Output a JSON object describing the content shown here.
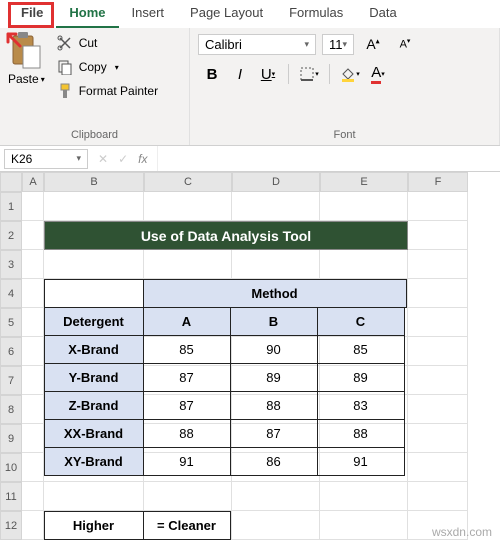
{
  "ribbon": {
    "tabs": {
      "file": "File",
      "home": "Home",
      "insert": "Insert",
      "pageLayout": "Page Layout",
      "formulas": "Formulas",
      "data": "Data"
    }
  },
  "clipboard": {
    "paste": "Paste",
    "cut": "Cut",
    "copy": "Copy",
    "formatPainter": "Format Painter",
    "groupLabel": "Clipboard"
  },
  "font": {
    "name": "Calibri",
    "size": "11",
    "groupLabel": "Font"
  },
  "namebox": "K26",
  "colHeaders": [
    "A",
    "B",
    "C",
    "D",
    "E",
    "F"
  ],
  "rowHeaders": [
    "1",
    "2",
    "3",
    "4",
    "5",
    "6",
    "7",
    "8",
    "9",
    "10",
    "11",
    "12"
  ],
  "title": "Use of Data Analysis Tool",
  "table": {
    "methodHeader": "Method",
    "detergentHeader": "Detergent",
    "cols": [
      "A",
      "B",
      "C"
    ],
    "rows": [
      {
        "label": "X-Brand",
        "vals": [
          "85",
          "90",
          "85"
        ]
      },
      {
        "label": "Y-Brand",
        "vals": [
          "87",
          "89",
          "89"
        ]
      },
      {
        "label": "Z-Brand",
        "vals": [
          "87",
          "88",
          "83"
        ]
      },
      {
        "label": "XX-Brand",
        "vals": [
          "88",
          "87",
          "88"
        ]
      },
      {
        "label": "XY-Brand",
        "vals": [
          "91",
          "86",
          "91"
        ]
      }
    ]
  },
  "legend": {
    "higher": "Higher",
    "cleaner": "= Cleaner"
  },
  "watermark": "wsxdn.com",
  "chart_data": {
    "type": "table",
    "title": "Use of Data Analysis Tool",
    "row_header": "Detergent",
    "col_header": "Method",
    "columns": [
      "A",
      "B",
      "C"
    ],
    "rows": [
      "X-Brand",
      "Y-Brand",
      "Z-Brand",
      "XX-Brand",
      "XY-Brand"
    ],
    "values": [
      [
        85,
        90,
        85
      ],
      [
        87,
        89,
        89
      ],
      [
        87,
        88,
        83
      ],
      [
        88,
        87,
        88
      ],
      [
        91,
        86,
        91
      ]
    ],
    "note": "Higher = Cleaner"
  }
}
